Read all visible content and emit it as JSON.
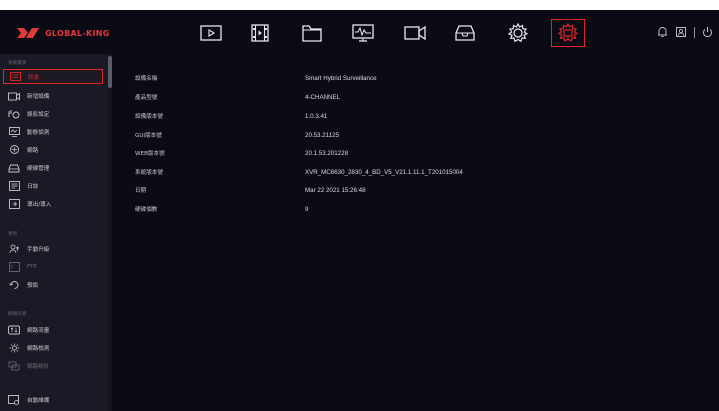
{
  "header": {
    "logo_text": "GLOBAL-KING",
    "nav_icons": [
      "playback-icon",
      "film-icon",
      "folder-icon",
      "monitor-icon",
      "camera-icon",
      "hdd-icon",
      "settings-icon",
      "system-settings-icon"
    ],
    "active_nav": "system-settings-icon",
    "accent": "#e0262b"
  },
  "sidebar": {
    "sections": [
      {
        "title": "系統資訊"
      },
      {
        "title": "更新"
      },
      {
        "title": "網路訊息"
      }
    ],
    "items": [
      {
        "label": "訊息",
        "icon": "info-icon",
        "active": true
      },
      {
        "label": "新增設備",
        "icon": "camera-add-icon"
      },
      {
        "label": "錄影設定",
        "icon": "record-icon"
      },
      {
        "label": "動態偵測",
        "icon": "motion-icon"
      },
      {
        "label": "網路",
        "icon": "network-icon"
      },
      {
        "label": "硬碟管理",
        "icon": "disk-icon"
      },
      {
        "label": "日誌",
        "icon": "log-icon"
      },
      {
        "label": "導出/導入",
        "icon": "export-icon"
      },
      {
        "label": "手動升級",
        "icon": "upgrade-icon"
      },
      {
        "label": "FTP",
        "icon": "ftp-icon",
        "dim": true
      },
      {
        "label": "預設",
        "icon": "default-icon"
      },
      {
        "label": "網路流量",
        "icon": "traffic-icon"
      },
      {
        "label": "網路檢測",
        "icon": "network-test-icon"
      },
      {
        "label": "網路統計",
        "icon": "net-stats-icon",
        "dim": true
      },
      {
        "label": "自動維護",
        "icon": "maintenance-icon"
      }
    ]
  },
  "info": {
    "rows": [
      {
        "key": "設備名稱",
        "value": "Smart Hybrid Surveillance"
      },
      {
        "key": "產品型號",
        "value": "4-CHANNEL"
      },
      {
        "key": "設備版本號",
        "value": "1.0.3.41"
      },
      {
        "key": "GUI版本號",
        "value": "20.53.21125"
      },
      {
        "key": "WEB版本號",
        "value": "20.1.53.201228"
      },
      {
        "key": "系統版本號",
        "value": "XVR_MC6630_2830_4_BD_V5_V21.1.11.1_T201015004"
      },
      {
        "key": "日期",
        "value": "Mar 22 2021  15:26:48"
      },
      {
        "key": "硬碟個數",
        "value": "9"
      }
    ]
  }
}
